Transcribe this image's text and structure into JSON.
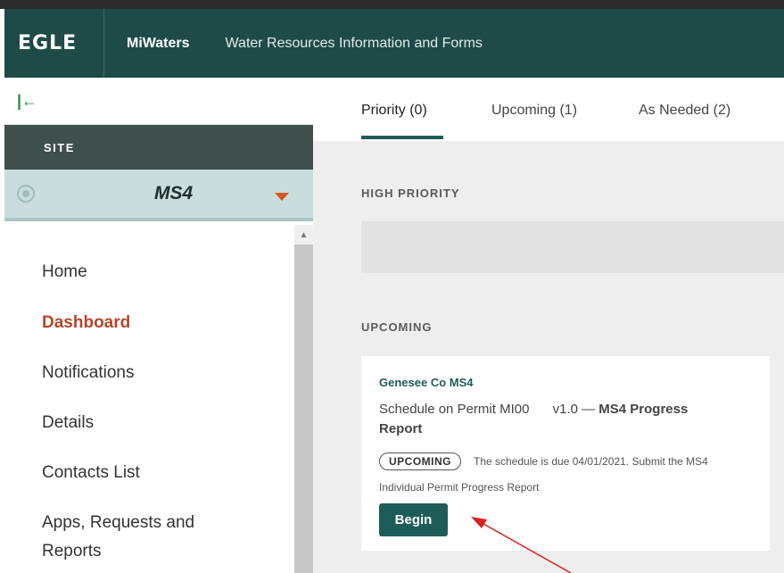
{
  "header": {
    "logo": "EGLE",
    "app_name": "MiWaters",
    "description": "Water Resources Information and Forms"
  },
  "sidebar": {
    "collapse_icon": "collapse-left-icon",
    "site_label": "SITE",
    "site_value": "MS4",
    "nav": [
      {
        "label": "Home"
      },
      {
        "label": "Dashboard"
      },
      {
        "label": "Notifications"
      },
      {
        "label": "Details"
      },
      {
        "label": "Contacts List"
      },
      {
        "label": "Apps, Requests and"
      },
      {
        "label": "Reports"
      }
    ]
  },
  "tabs": [
    {
      "label": "Priority (0)"
    },
    {
      "label": "Upcoming (1)"
    },
    {
      "label": "As Needed (2)"
    }
  ],
  "sections": {
    "high_priority": "HIGH PRIORITY",
    "upcoming": "UPCOMING"
  },
  "card": {
    "title": "Genesee Co MS4",
    "line1_a": "Schedule on Permit MI00",
    "line1_b": "v1.0 —",
    "line1_c": "MS4 Progress",
    "line2": "Report",
    "badge": "UPCOMING",
    "due_line1": "The schedule is due 04/01/2021. Submit the MS4",
    "due_line2": "Individual Permit Progress Report",
    "button": "Begin"
  },
  "colors": {
    "header_bg": "#1e4b47",
    "accent": "#1e5c58",
    "active_nav": "#b5462a",
    "annotation_arrow": "#e0201b"
  }
}
